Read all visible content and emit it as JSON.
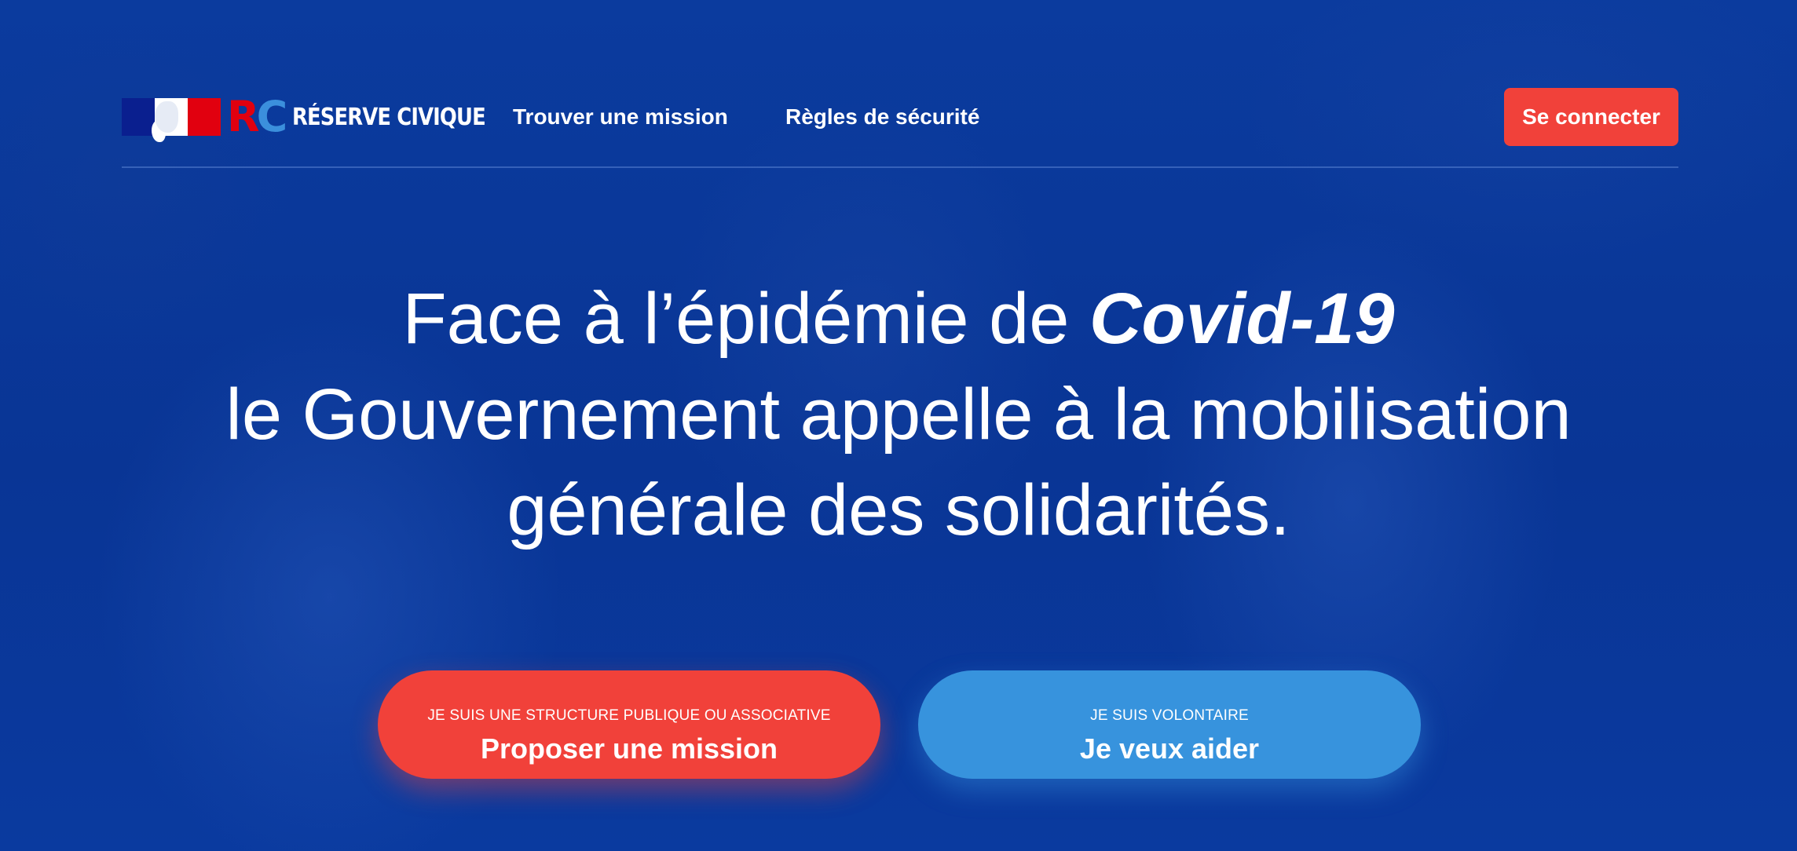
{
  "header": {
    "brand": "RÉSERVE CIVIQUE",
    "brand_mark": "RC",
    "nav": [
      {
        "label": "Trouver une mission"
      },
      {
        "label": "Règles de sécurité"
      }
    ],
    "login_label": "Se connecter"
  },
  "hero": {
    "line1_prefix": "Face à l’épidémie de ",
    "line1_emphasis": "Covid-19",
    "line2": "le Gouvernement appelle à la mobilisation",
    "line3": "générale des solidarités."
  },
  "cta": {
    "organization": {
      "kicker": "JE SUIS UNE STRUCTURE PUBLIQUE OU ASSOCIATIVE",
      "label": "Proposer une mission"
    },
    "volunteer": {
      "kicker": "JE SUIS VOLONTAIRE",
      "label": "Je veux aider"
    }
  },
  "colors": {
    "background": "#0a3a9c",
    "accent_red": "#f1413a",
    "accent_blue": "#3793dd",
    "flag_blue": "#0a1f8f",
    "flag_red": "#e1000f"
  },
  "icons": [
    "marianne-logo-icon",
    "rc-logo-icon"
  ]
}
